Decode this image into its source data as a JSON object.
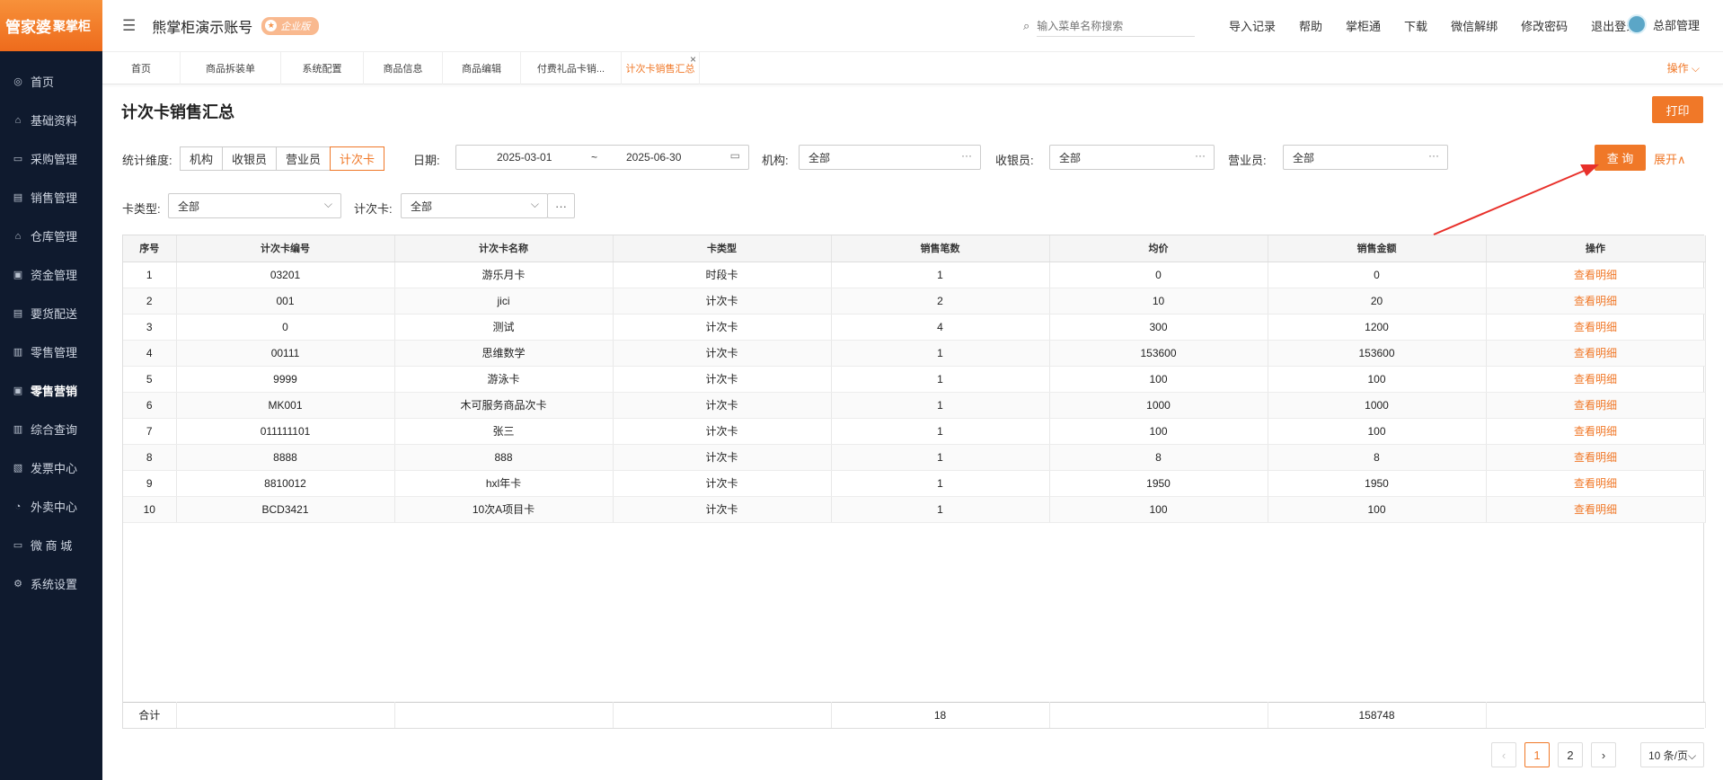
{
  "brand": {
    "logo_main": "管家婆",
    "logo_sub": "聚掌柜"
  },
  "sidebar": {
    "items": [
      {
        "label": "首页",
        "icon": "globe-icon",
        "glyph": "◎"
      },
      {
        "label": "基础资料",
        "icon": "home-icon",
        "glyph": "⌂"
      },
      {
        "label": "采购管理",
        "icon": "cart-icon",
        "glyph": "▭"
      },
      {
        "label": "销售管理",
        "icon": "register-icon",
        "glyph": "▤"
      },
      {
        "label": "仓库管理",
        "icon": "warehouse-icon",
        "glyph": "⌂"
      },
      {
        "label": "资金管理",
        "icon": "money-icon",
        "glyph": "▣"
      },
      {
        "label": "要货配送",
        "icon": "delivery-icon",
        "glyph": "▤"
      },
      {
        "label": "零售管理",
        "icon": "chart-icon",
        "glyph": "▥"
      },
      {
        "label": "零售营销",
        "icon": "bag-icon",
        "glyph": "▣"
      },
      {
        "label": "综合查询",
        "icon": "bar-chart-icon",
        "glyph": "▥"
      },
      {
        "label": "发票中心",
        "icon": "invoice-icon",
        "glyph": "▧"
      },
      {
        "label": "外卖中心",
        "icon": "takeout-icon",
        "glyph": "◔"
      },
      {
        "label": "微 商 城",
        "icon": "shop-icon",
        "glyph": "▭"
      },
      {
        "label": "系统设置",
        "icon": "gear-icon",
        "glyph": "⚙"
      }
    ],
    "active_index": 8
  },
  "header": {
    "account_name": "熊掌柜演示账号",
    "badge": "企业版",
    "search_placeholder": "输入菜单名称搜索",
    "links": [
      "导入记录",
      "帮助",
      "掌柜通",
      "下载",
      "微信解绑",
      "修改密码",
      "退出登录"
    ],
    "user": "总部管理"
  },
  "tabs": {
    "items": [
      "首页",
      "商品拆装单",
      "系统配置",
      "商品信息",
      "商品编辑",
      "付费礼品卡销...",
      "计次卡销售汇总"
    ],
    "active_index": 6,
    "ops": "操作 ⌵"
  },
  "page": {
    "title": "计次卡销售汇总",
    "print": "打印"
  },
  "filters": {
    "dimension_label": "统计维度:",
    "dimension_options": [
      "机构",
      "收银员",
      "营业员",
      "计次卡"
    ],
    "date_label": "日期:",
    "date_from": "2025-03-01",
    "date_sep": "~",
    "date_to": "2025-06-30",
    "org_label": "机构:",
    "org_value": "全部",
    "cashier_label": "收银员:",
    "cashier_value": "全部",
    "sales_label": "营业员:",
    "sales_value": "全部",
    "cardtype_label": "卡类型:",
    "cardtype_value": "全部",
    "card_label": "计次卡:",
    "card_value": "全部",
    "query": "查 询",
    "expand": "展开∧",
    "more": "···"
  },
  "table": {
    "columns": [
      "序号",
      "计次卡编号",
      "计次卡名称",
      "卡类型",
      "销售笔数",
      "均价",
      "销售金额",
      "操作"
    ],
    "rows": [
      [
        "1",
        "03201",
        "游乐月卡",
        "时段卡",
        "1",
        "0",
        "0",
        "查看明细"
      ],
      [
        "2",
        "001",
        "jici",
        "计次卡",
        "2",
        "10",
        "20",
        "查看明细"
      ],
      [
        "3",
        "0",
        "测试",
        "计次卡",
        "4",
        "300",
        "1200",
        "查看明细"
      ],
      [
        "4",
        "00111",
        "思维数学",
        "计次卡",
        "1",
        "153600",
        "153600",
        "查看明细"
      ],
      [
        "5",
        "9999",
        "游泳卡",
        "计次卡",
        "1",
        "100",
        "100",
        "查看明细"
      ],
      [
        "6",
        "MK001",
        "木可服务商品次卡",
        "计次卡",
        "1",
        "1000",
        "1000",
        "查看明细"
      ],
      [
        "7",
        "011111101",
        "张三",
        "计次卡",
        "1",
        "100",
        "100",
        "查看明细"
      ],
      [
        "8",
        "8888",
        "888",
        "计次卡",
        "1",
        "8",
        "8",
        "查看明细"
      ],
      [
        "9",
        "8810012",
        "hxl年卡",
        "计次卡",
        "1",
        "1950",
        "1950",
        "查看明细"
      ],
      [
        "10",
        "BCD3421",
        "10次A项目卡",
        "计次卡",
        "1",
        "100",
        "100",
        "查看明细"
      ]
    ],
    "total": [
      "合计",
      "",
      "",
      "",
      "18",
      "",
      "158748",
      ""
    ]
  },
  "pagination": {
    "prev": "‹",
    "pages": [
      "1",
      "2"
    ],
    "current": "1",
    "next": "›",
    "page_size": "10 条/页⌵"
  }
}
